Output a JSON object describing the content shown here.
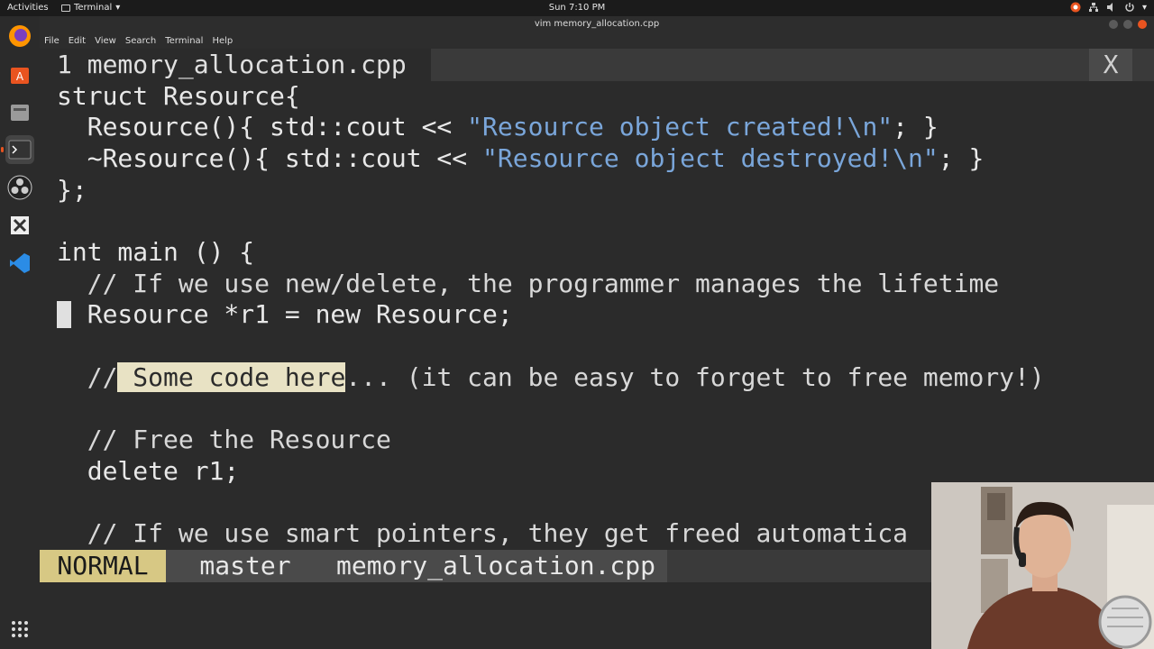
{
  "topbar": {
    "activities": "Activities",
    "app_name": "Terminal",
    "clock": "Sun  7:10 PM"
  },
  "window": {
    "title": "vim memory_allocation.cpp"
  },
  "menu": [
    "File",
    "Edit",
    "View",
    "Search",
    "Terminal",
    "Help"
  ],
  "vim": {
    "tab_label": "1 memory_allocation.cpp",
    "tab_close": "X",
    "lines": {
      "l1": "struct Resource{",
      "l2a": "  Resource(){ std::cout << ",
      "l2b": "\"Resource object created!\\n\"",
      "l2c": "; }",
      "l3a": "  ~Resource(){ std::cout << ",
      "l3b": "\"Resource object destroyed!\\n\"",
      "l3c": "; }",
      "l4": "};",
      "l6": "int main () {",
      "l7": "  // If we use new/delete, the programmer manages the lifetime",
      "l8": "  Resource *r1 = new Resource;",
      "l10a": "  //",
      "l10b": " Some code here",
      "l10c": "... (it can be easy to forget to free memory!)",
      "l12": "  // Free the Resource",
      "l13": "  delete r1;",
      "l15": "  // If we use smart pointers, they get freed automatica"
    },
    "status": {
      "mode": "NORMAL",
      "branch": "master",
      "file": "memory_allocation.cpp"
    }
  },
  "colors": {
    "accent": "#e95420",
    "mode_bg": "#d7c884",
    "string": "#7aa6da"
  }
}
